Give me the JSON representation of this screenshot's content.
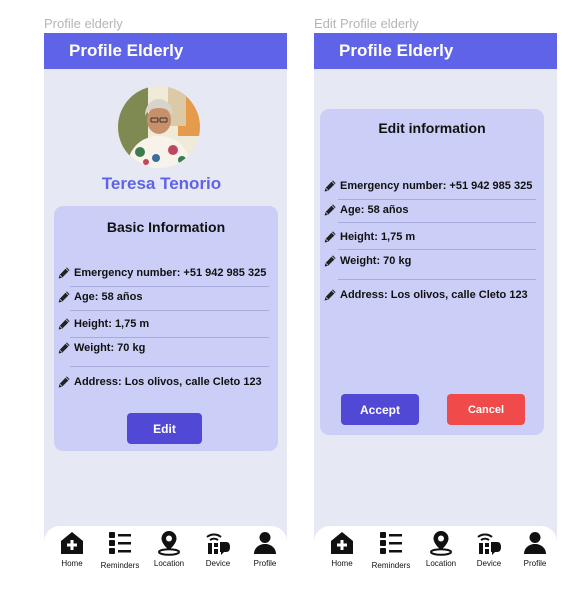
{
  "frames": {
    "left_label": "Profile elderly",
    "right_label": "Edit Profile elderly"
  },
  "appbar": {
    "title": "Profile Elderly"
  },
  "profile": {
    "name": "Teresa Tenorio",
    "card_title": "Basic Information",
    "emergency": "Emergency number: +51 942 985 325",
    "age": "Age: 58 años",
    "height": "Height: 1,75 m",
    "weight": "Weight: 70 kg",
    "address": "Address: Los olivos, calle Cleto 123",
    "edit_label": "Edit"
  },
  "edit": {
    "card_title": "Edit information",
    "accept_label": "Accept",
    "cancel_label": "Cancel"
  },
  "navbar": {
    "items": [
      {
        "label": "Home",
        "icon": "home-plus-icon"
      },
      {
        "label": "Reminders",
        "icon": "list-icon"
      },
      {
        "label": "Location",
        "icon": "location-pin-icon"
      },
      {
        "label": "Device",
        "icon": "device-icon"
      },
      {
        "label": "Profile",
        "icon": "person-icon"
      }
    ]
  },
  "colors": {
    "primary": "#5f63e8",
    "button": "#5248d6",
    "cancel": "#f04a4a",
    "card": "#cbcef6",
    "screen": "#e6e9f4"
  }
}
